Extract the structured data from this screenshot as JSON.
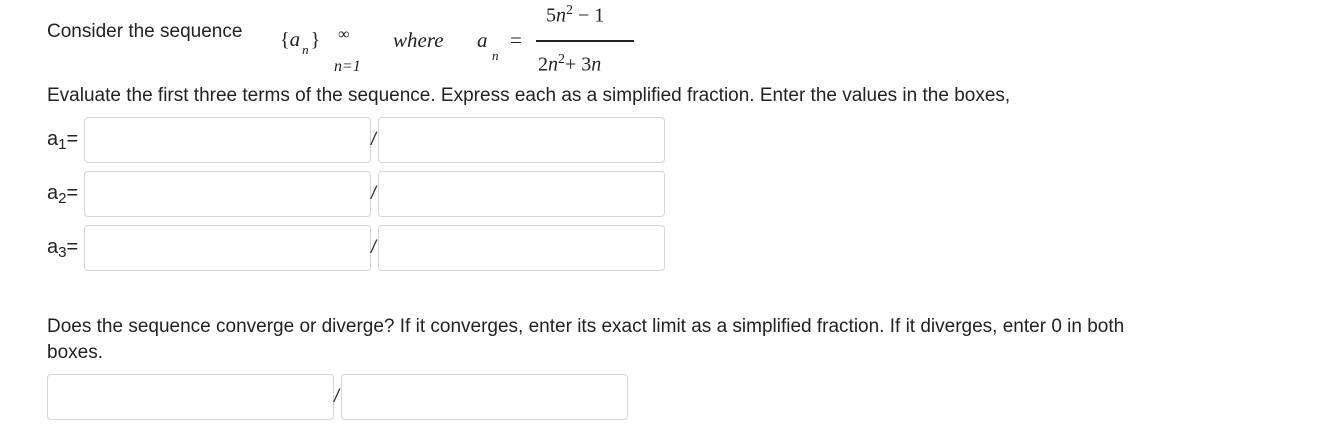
{
  "question": {
    "intro": "Consider the sequence",
    "sequence": {
      "open": "{",
      "var": "a",
      "sub": "n",
      "close": "}",
      "upper": "∞",
      "lower": "n=1"
    },
    "where": "where",
    "def": {
      "lhs_var": "a",
      "lhs_sub": "n",
      "eq": "=",
      "num_coef": "5",
      "num_var": "n",
      "num_exp": "2",
      "num_tail": " − 1",
      "den_coef": "2",
      "den_var": "n",
      "den_exp": "2",
      "den_tail": "+ 3",
      "den_tail_var": "n"
    },
    "instruction": "Evaluate the first three terms of the sequence.  Express each as a simplified fraction.  Enter the values in the boxes,",
    "separator": "/",
    "terms": [
      {
        "label": "a",
        "sub": "1",
        "suffix": "=",
        "numerator": "",
        "denominator": ""
      },
      {
        "label": "a",
        "sub": "2",
        "suffix": "=",
        "numerator": "",
        "denominator": ""
      },
      {
        "label": "a",
        "sub": "3",
        "suffix": "=",
        "numerator": "",
        "denominator": ""
      }
    ],
    "limit_prompt": "Does the sequence converge or diverge?  If it converges, enter its exact limit as a simplified fraction.  If it diverges, enter 0 in both",
    "limit_prompt_cont": "boxes.",
    "limit": {
      "numerator": "",
      "denominator": ""
    }
  },
  "colors": {
    "text": "#222222",
    "box_border": "#d6d6d6"
  }
}
